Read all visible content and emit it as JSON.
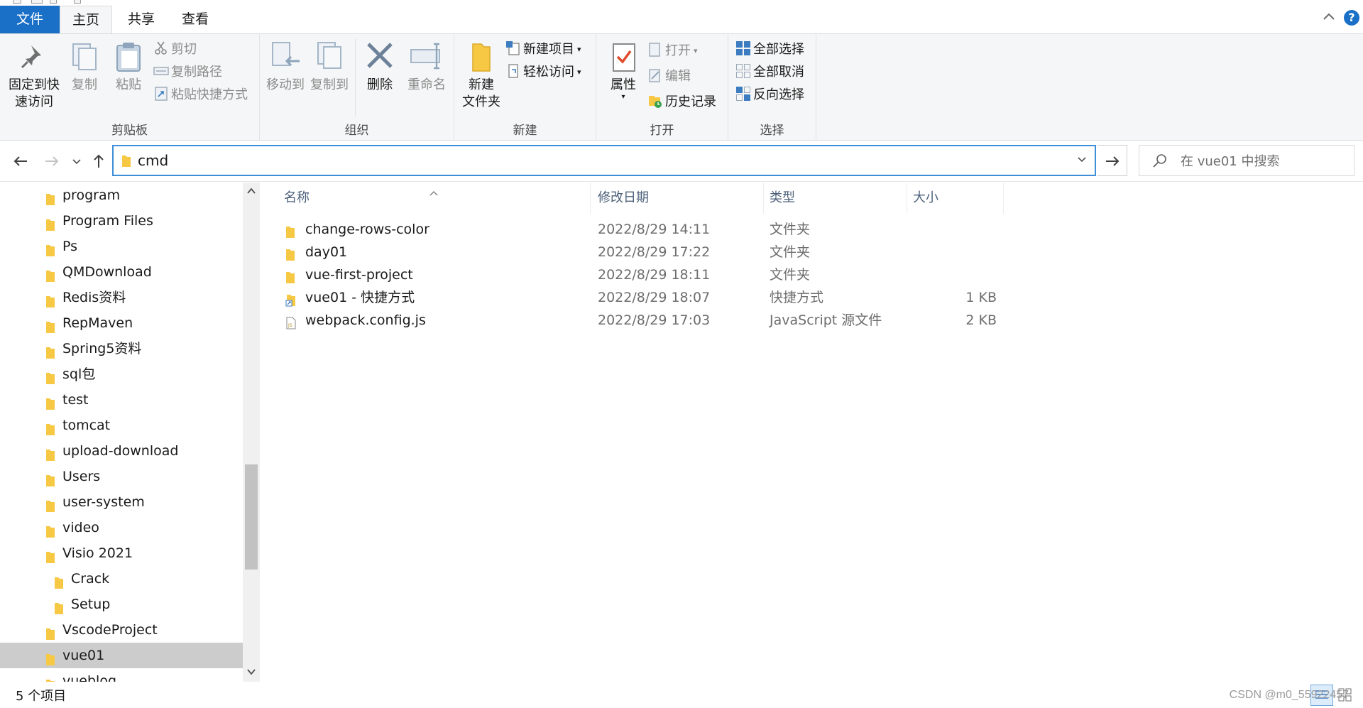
{
  "tabs": {
    "file": "文件",
    "home": "主页",
    "share": "共享",
    "view": "查看"
  },
  "help": {
    "glyph": "?"
  },
  "ribbon": {
    "clipboard": {
      "label": "剪贴板",
      "pin_line1": "固定到快",
      "pin_line2": "速访问",
      "copy": "复制",
      "paste": "粘贴",
      "cut": "剪切",
      "copy_path": "复制路径",
      "paste_shortcut": "粘贴快捷方式"
    },
    "organize": {
      "label": "组织",
      "move_to": "移动到",
      "copy_to": "复制到",
      "delete": "删除",
      "rename": "重命名"
    },
    "new": {
      "label": "新建",
      "new_folder_line1": "新建",
      "new_folder_line2": "文件夹",
      "new_item": "新建项目",
      "easy_access": "轻松访问"
    },
    "open": {
      "label": "打开",
      "properties": "属性",
      "open": "打开",
      "edit": "编辑",
      "history": "历史记录"
    },
    "select": {
      "label": "选择",
      "select_all": "全部选择",
      "select_none": "全部取消",
      "invert": "反向选择"
    }
  },
  "address": {
    "value": "cmd"
  },
  "search": {
    "placeholder": "在 vue01 中搜索"
  },
  "tree": [
    {
      "label": "program",
      "indent": 0
    },
    {
      "label": "Program Files",
      "indent": 0
    },
    {
      "label": "Ps",
      "indent": 0
    },
    {
      "label": "QMDownload",
      "indent": 0
    },
    {
      "label": "Redis资料",
      "indent": 0
    },
    {
      "label": "RepMaven",
      "indent": 0
    },
    {
      "label": "Spring5资料",
      "indent": 0
    },
    {
      "label": "sql包",
      "indent": 0
    },
    {
      "label": "test",
      "indent": 0
    },
    {
      "label": "tomcat",
      "indent": 0
    },
    {
      "label": "upload-download",
      "indent": 0
    },
    {
      "label": "Users",
      "indent": 0
    },
    {
      "label": "user-system",
      "indent": 0
    },
    {
      "label": "video",
      "indent": 0
    },
    {
      "label": "Visio 2021",
      "indent": 0
    },
    {
      "label": "Crack",
      "indent": 1
    },
    {
      "label": "Setup",
      "indent": 1
    },
    {
      "label": "VscodeProject",
      "indent": 0
    },
    {
      "label": "vue01",
      "indent": 0,
      "selected": true
    },
    {
      "label": "vueblog",
      "indent": 0
    }
  ],
  "columns": {
    "name": "名称",
    "date": "修改日期",
    "type": "类型",
    "size": "大小"
  },
  "files": [
    {
      "name": "change-rows-color",
      "date": "2022/8/29 14:11",
      "type": "文件夹",
      "size": "",
      "icon": "folder-icon"
    },
    {
      "name": "day01",
      "date": "2022/8/29 17:22",
      "type": "文件夹",
      "size": "",
      "icon": "folder-icon"
    },
    {
      "name": "vue-first-project",
      "date": "2022/8/29 18:11",
      "type": "文件夹",
      "size": "",
      "icon": "folder-icon"
    },
    {
      "name": "vue01 - 快捷方式",
      "date": "2022/8/29 18:07",
      "type": "快捷方式",
      "size": "1 KB",
      "icon": "shortcut-icon"
    },
    {
      "name": "webpack.config.js",
      "date": "2022/8/29 17:03",
      "type": "JavaScript 源文件",
      "size": "2 KB",
      "icon": "js-file-icon"
    }
  ],
  "status": {
    "count": "5 个项目",
    "watermark": "CSDN @m0_55922457"
  },
  "colors": {
    "accent": "#1a6fc7",
    "folder": "#f6c844",
    "selection": "#cccccc",
    "header_text": "#4c607a"
  }
}
